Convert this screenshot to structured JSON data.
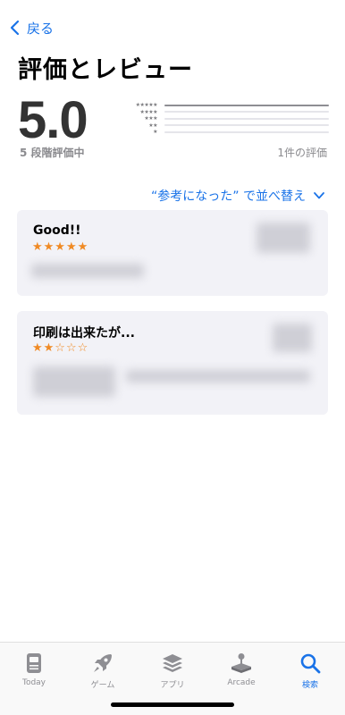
{
  "nav": {
    "back_label": "戻る"
  },
  "page": {
    "title": "評価とレビュー"
  },
  "summary": {
    "score": "5.0",
    "out_of": "5 段階評価中",
    "count": "1件の評価",
    "distribution": [
      {
        "stars": "★★★★★",
        "fraction": 1.0
      },
      {
        "stars": "★★★★",
        "fraction": 0
      },
      {
        "stars": "★★★",
        "fraction": 0
      },
      {
        "stars": "★★",
        "fraction": 0
      },
      {
        "stars": "★",
        "fraction": 0
      }
    ]
  },
  "sort": {
    "label": "“参考になった” で並べ替え"
  },
  "reviews": [
    {
      "title": "Good!!",
      "stars": "★★★★★",
      "rating": 5
    },
    {
      "title": "印刷は出来たが...",
      "stars": "★★☆☆☆",
      "rating": 2
    }
  ],
  "tabs": [
    {
      "label": "Today",
      "icon": "today-icon",
      "active": false
    },
    {
      "label": "ゲーム",
      "icon": "rocket-icon",
      "active": false
    },
    {
      "label": "アプリ",
      "icon": "layers-icon",
      "active": false
    },
    {
      "label": "Arcade",
      "icon": "joystick-icon",
      "active": false
    },
    {
      "label": "検索",
      "icon": "search-icon",
      "active": true
    }
  ],
  "colors": {
    "accent": "#1a73e8",
    "star": "#f08a24",
    "card_bg": "#f2f2f7"
  }
}
